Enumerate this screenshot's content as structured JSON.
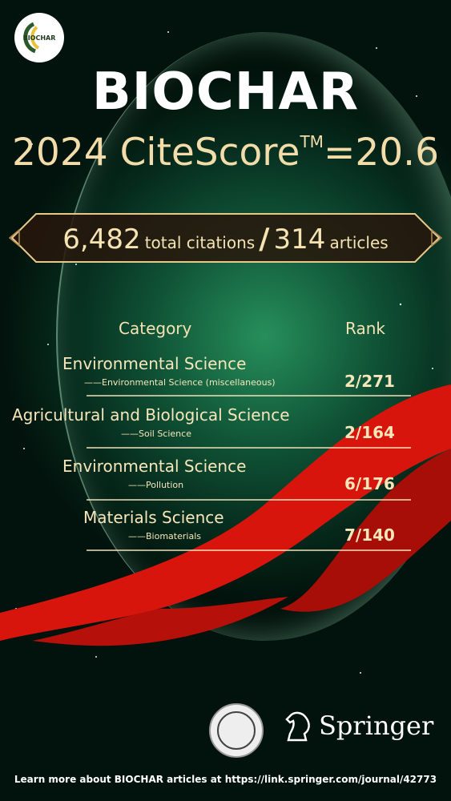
{
  "logo": {
    "text": "BIOCHAR"
  },
  "title": "BIOCHAR",
  "citescore": {
    "prefix": "2024 CiteScore",
    "tm": "TM",
    "value": "=20.6"
  },
  "banner": {
    "citations": "6,482",
    "citations_label": "total citations",
    "sep": "/",
    "articles": "314",
    "articles_label": "articles"
  },
  "table": {
    "header_category": "Category",
    "header_rank": "Rank",
    "rows": [
      {
        "category": "Environmental Science",
        "subcategory": "——Environmental Science (miscellaneous)",
        "rank": "2/271"
      },
      {
        "category": "Agricultural and Biological Science",
        "subcategory": "——Soil Science",
        "rank": "2/164"
      },
      {
        "category": "Environmental Science",
        "subcategory": "——Pollution",
        "rank": "6/176"
      },
      {
        "category": "Materials Science",
        "subcategory": "——Biomaterials",
        "rank": "7/140"
      }
    ]
  },
  "springer": {
    "name": "Springer"
  },
  "footer": "Learn more about BIOCHAR articles at https://link.springer.com/journal/42773",
  "colors": {
    "gold": "#f2ddaa",
    "ribbon": "#d8150c",
    "background": "#03140f"
  }
}
